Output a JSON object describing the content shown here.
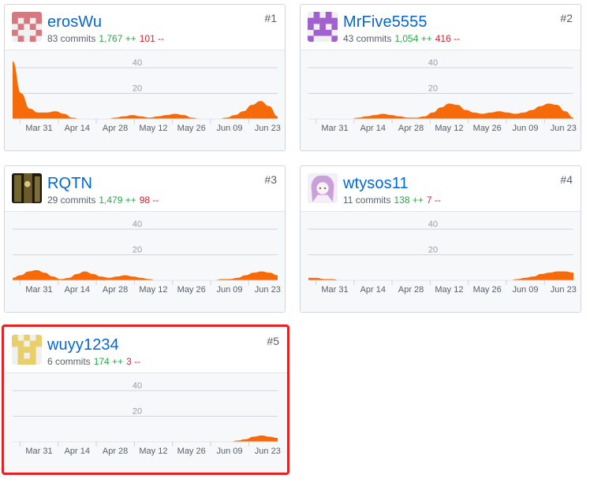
{
  "contributors": [
    {
      "rank": "#1",
      "username": "erosWu",
      "commits": "83 commits",
      "additions": "1,767 ++",
      "deletions": "101 --",
      "avatar": {
        "icon": "identicon-avatar",
        "color": "#d9777f",
        "bg": "#f0f0f0"
      },
      "chart_data": {
        "type": "area",
        "series": [
          {
            "values": [
              45,
              20,
              8,
              5,
              5,
              6,
              4,
              1,
              0,
              0,
              0,
              0,
              1,
              2,
              3,
              2,
              1,
              2,
              3,
              4,
              3,
              1,
              0,
              0,
              0,
              1,
              3,
              6,
              11,
              14,
              10,
              2
            ]
          }
        ],
        "x_tick_labels": [
          "Mar 31",
          "Apr 14",
          "Apr 28",
          "May 12",
          "May 26",
          "Jun 09",
          "Jun 23"
        ],
        "y_tick_labels": [
          "20",
          "40"
        ],
        "ylim": [
          0,
          50
        ],
        "color": "#f66a0a"
      }
    },
    {
      "rank": "#2",
      "username": "MrFive5555",
      "commits": "43 commits",
      "additions": "1,054 ++",
      "deletions": "416 --",
      "avatar": {
        "icon": "identicon-avatar",
        "color": "#a25fd0",
        "bg": "#f0f0f0"
      },
      "chart_data": {
        "type": "area",
        "series": [
          {
            "values": [
              0,
              0,
              0,
              0,
              0,
              0,
              1,
              2,
              3,
              4,
              3,
              2,
              1,
              1,
              2,
              5,
              9,
              12,
              11,
              7,
              5,
              4,
              5,
              6,
              5,
              4,
              5,
              7,
              10,
              12,
              11,
              6,
              1
            ]
          }
        ],
        "x_tick_labels": [
          "Mar 31",
          "Apr 14",
          "Apr 28",
          "May 12",
          "May 26",
          "Jun 09",
          "Jun 23"
        ],
        "y_tick_labels": [
          "20",
          "40"
        ],
        "ylim": [
          0,
          50
        ],
        "color": "#f66a0a"
      }
    },
    {
      "rank": "#3",
      "username": "RQTN",
      "commits": "29 commits",
      "additions": "1,479 ++",
      "deletions": "98 --",
      "avatar": {
        "icon": "photo-avatar",
        "color": "#6b5a2a",
        "bg": "#222"
      },
      "chart_data": {
        "type": "area",
        "series": [
          {
            "values": [
              2,
              4,
              7,
              8,
              6,
              3,
              1,
              2,
              5,
              7,
              5,
              3,
              2,
              3,
              4,
              3,
              2,
              1,
              0,
              0,
              0,
              0,
              0,
              0,
              0,
              0,
              1,
              1,
              2,
              4,
              6,
              7,
              6,
              4
            ]
          }
        ],
        "x_tick_labels": [
          "Mar 31",
          "Apr 14",
          "Apr 28",
          "May 12",
          "May 26",
          "Jun 09",
          "Jun 23"
        ],
        "y_tick_labels": [
          "20",
          "40"
        ],
        "ylim": [
          0,
          50
        ],
        "color": "#f66a0a"
      }
    },
    {
      "rank": "#4",
      "username": "wtysos11",
      "commits": "11 commits",
      "additions": "138 ++",
      "deletions": "7 --",
      "avatar": {
        "icon": "anime-avatar",
        "color": "#c9a0d8",
        "bg": "#f4eef8"
      },
      "chart_data": {
        "type": "area",
        "series": [
          {
            "values": [
              2,
              2,
              1,
              1,
              0,
              0,
              0,
              0,
              0,
              0,
              0,
              0,
              0,
              0,
              0,
              0,
              0,
              0,
              0,
              0,
              0,
              0,
              0,
              0,
              0,
              0,
              1,
              2,
              3,
              5,
              6,
              7,
              7,
              6
            ]
          }
        ],
        "x_tick_labels": [
          "Mar 31",
          "Apr 14",
          "Apr 28",
          "May 12",
          "May 26",
          "Jun 09",
          "Jun 23"
        ],
        "y_tick_labels": [
          "20",
          "40"
        ],
        "ylim": [
          0,
          50
        ],
        "color": "#f66a0a"
      }
    },
    {
      "rank": "#5",
      "username": "wuyy1234",
      "commits": "6 commits",
      "additions": "174 ++",
      "deletions": "3 --",
      "avatar": {
        "icon": "identicon-avatar",
        "color": "#e8cf6a",
        "bg": "#f0f0f0"
      },
      "chart_data": {
        "type": "area",
        "series": [
          {
            "values": [
              0,
              0,
              0,
              0,
              0,
              0,
              0,
              0,
              0,
              0,
              0,
              0,
              0,
              0,
              0,
              0,
              0,
              0,
              0,
              0,
              0,
              0,
              0,
              0,
              0,
              0,
              0,
              0,
              1,
              2,
              4,
              5,
              4,
              3
            ]
          }
        ],
        "x_tick_labels": [
          "Mar 31",
          "Apr 14",
          "Apr 28",
          "May 12",
          "May 26",
          "Jun 09",
          "Jun 23"
        ],
        "y_tick_labels": [
          "20",
          "40"
        ],
        "ylim": [
          0,
          50
        ],
        "color": "#f66a0a"
      }
    }
  ]
}
